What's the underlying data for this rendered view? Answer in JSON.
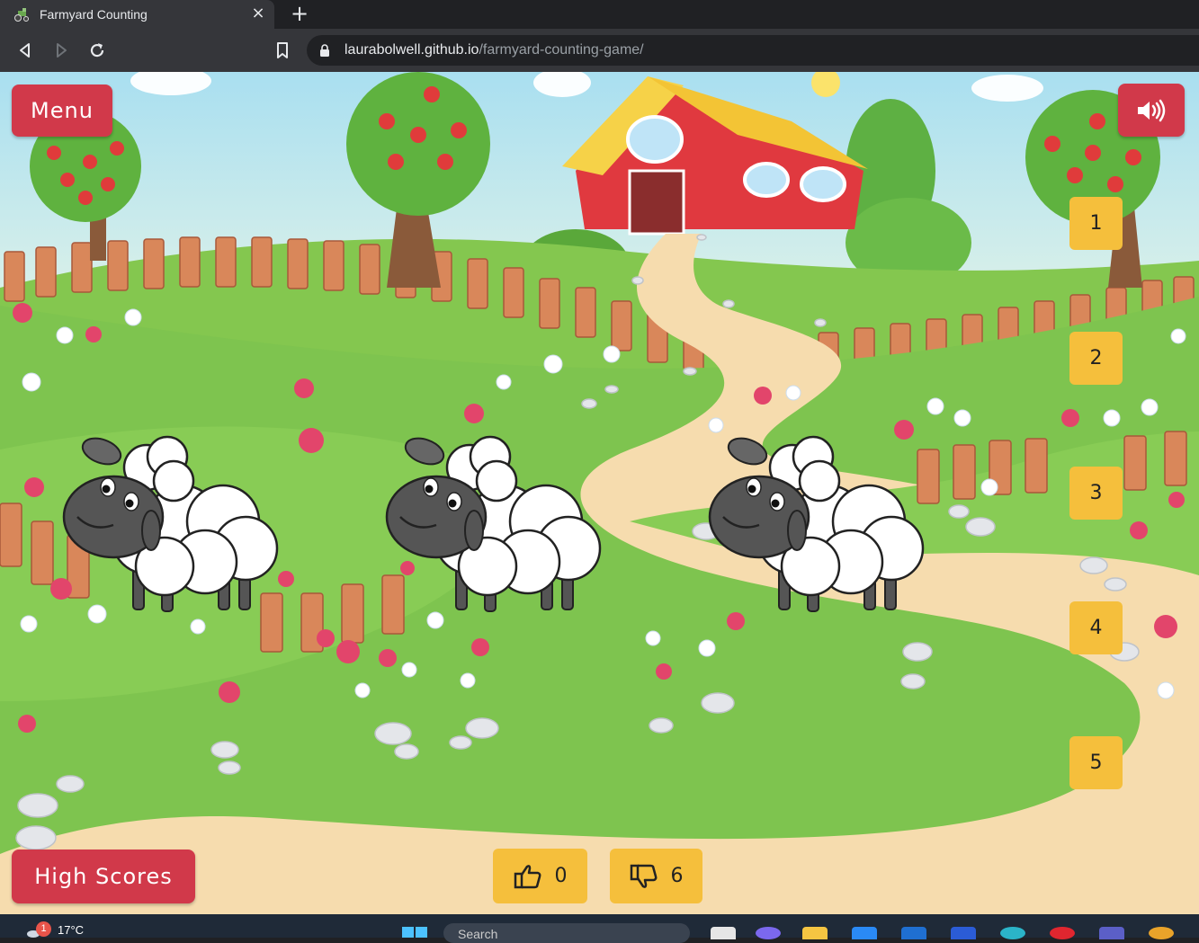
{
  "browser": {
    "tab_title": "Farmyard Counting",
    "tab_close": "×",
    "new_tab": "+",
    "url_host": "laurabolwell.github.io",
    "url_path": "/farmyard-counting-game/"
  },
  "game": {
    "menu_label": "Menu",
    "high_scores_label": "High Scores",
    "sound_icon": "volume-up-icon",
    "answer_options": [
      "1",
      "2",
      "3",
      "4",
      "5"
    ],
    "correct_count": "0",
    "incorrect_count": "6",
    "animal": "sheep",
    "animals_shown": 3
  },
  "taskbar": {
    "notification_count": "1",
    "temperature": "17°C",
    "search_placeholder": "Search"
  },
  "colors": {
    "red_button": "#d1394a",
    "yellow_button": "#f5bf3c",
    "grass": "#7cc14a",
    "sky": "#bfe6f2",
    "path": "#f3dcae"
  }
}
